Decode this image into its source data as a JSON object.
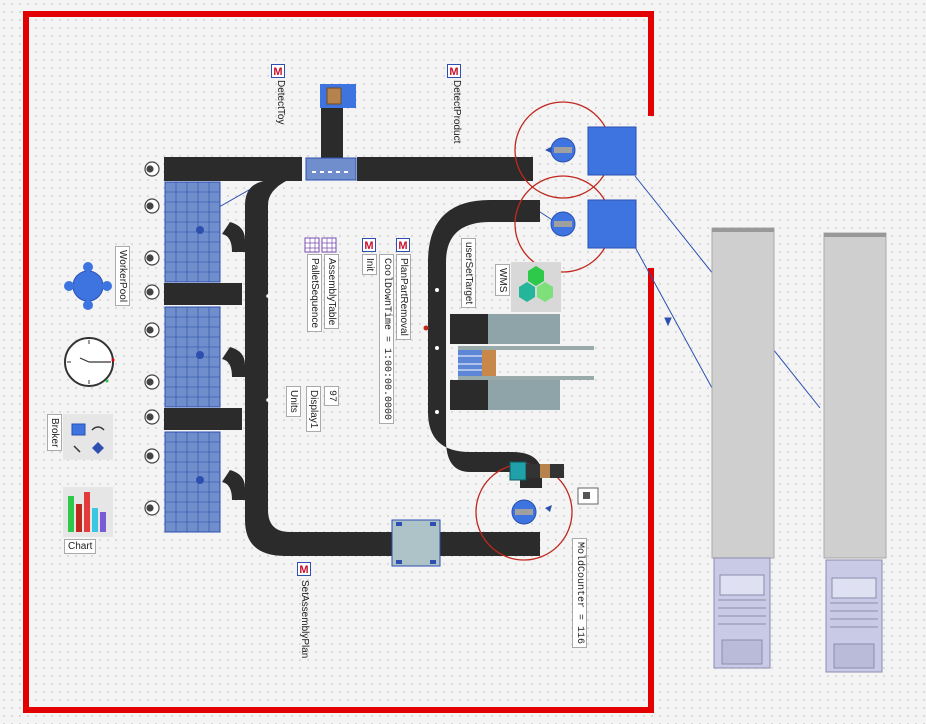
{
  "labels": {
    "detect_toy": "DetectToy",
    "detect_product": "DetectProduct",
    "pallet_sequence": "PalletSequence",
    "assembly_table": "AssemblyTable",
    "init": "Init",
    "plan_part_removal": "PlanPartRemoval",
    "cool_down_time": "CoolDownTime = 1:00:00.0000",
    "user_set_target": "userSetTarget",
    "wms": "WMS",
    "worker_pool": "WorkerPool",
    "broker": "Broker",
    "chart": "Chart",
    "display_value": "97",
    "display_name": "Display1",
    "units": "Units",
    "set_assembly_plan": "SetAssemblyPlan",
    "mold_counter": "MoldCounter = 116"
  },
  "icons": {
    "method": "M",
    "method_icon": "method-icon",
    "table_icon": "table-icon",
    "worker_pool_icon": "worker-pool-icon",
    "clock_icon": "clock-icon",
    "broker_icon": "broker-icon",
    "chart_icon": "chart-icon",
    "robot_icon": "robot-icon",
    "truck_icon": "truck-icon"
  },
  "colors": {
    "boundary": "#e30000",
    "conveyor": "#2b2b2b",
    "station": "#3d74e0",
    "grid_blue": "#4a72c8",
    "robot_radius": "#c0281e",
    "truck_body": "#cfcfcf",
    "truck_cab": "#c9cbe6"
  }
}
